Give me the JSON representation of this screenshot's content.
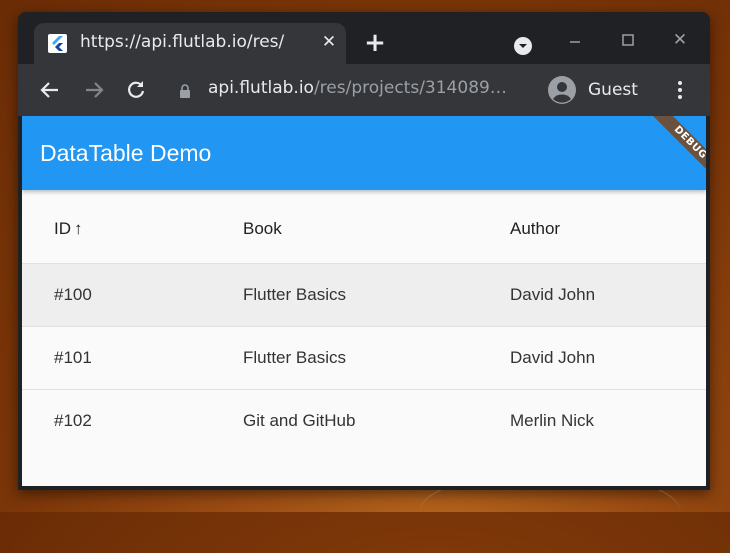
{
  "browser": {
    "tab": {
      "title": "https://api.flutlab.io/res/"
    },
    "omnibox": {
      "host": "api.flutlab.io",
      "path": "/res/projects/314089…"
    },
    "profile": {
      "name": "Guest"
    }
  },
  "app": {
    "title": "DataTable Demo",
    "debug_banner": "DEBUG",
    "accent_color": "#2196f3",
    "table": {
      "columns": [
        "ID",
        "Book",
        "Author"
      ],
      "sort_column": "ID",
      "sort_direction": "ascending",
      "sort_icon": "↑",
      "rows": [
        {
          "id": "#100",
          "book": "Flutter Basics",
          "author": "David John"
        },
        {
          "id": "#101",
          "book": "Flutter Basics",
          "author": "David John"
        },
        {
          "id": "#102",
          "book": "Git and GitHub",
          "author": "Merlin Nick"
        }
      ]
    }
  }
}
